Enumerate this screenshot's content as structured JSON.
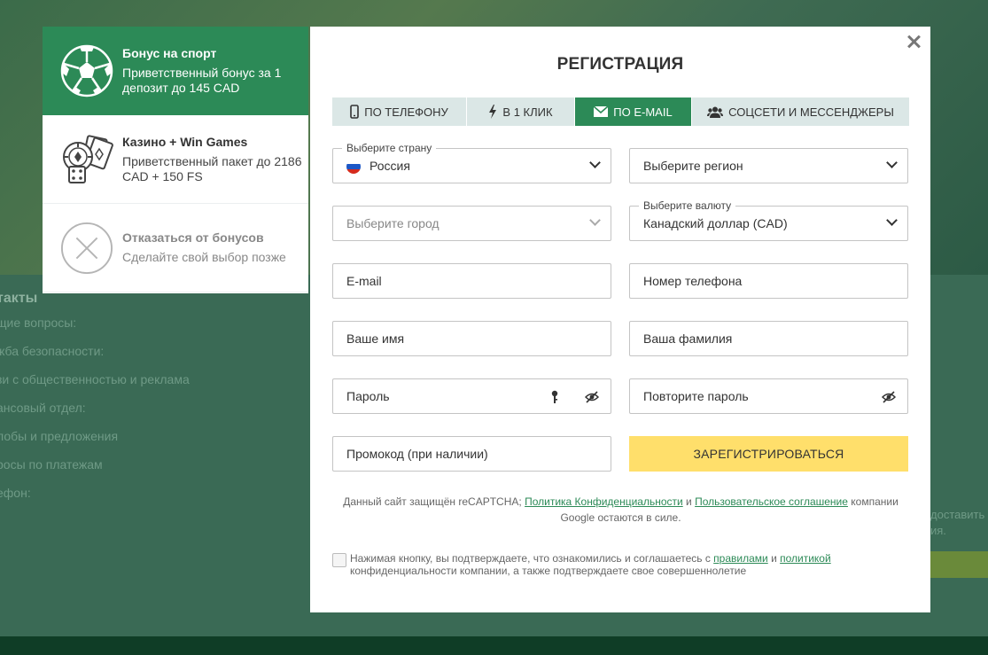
{
  "background": {
    "contacts_title": "такты",
    "contacts_links": [
      "щие вопросы:",
      "жба безопасности:",
      "зи с общественностью и реклама",
      "ансовый отдел:",
      "лобы и предложения",
      "росы по платежам",
      "ефон:"
    ],
    "right_text_line1": "доставить",
    "right_text_line2": "ия."
  },
  "bonus_panel": {
    "items": [
      {
        "title": "Бонус на спорт",
        "desc": "Приветственный бонус за 1 депозит до 145 CAD",
        "icon": "soccer-ball-icon"
      },
      {
        "title": "Казино + Win Games",
        "desc": "Приветственный пакет до 2186 CAD + 150 FS",
        "icon": "casino-chip-dice-icon"
      },
      {
        "title": "Отказаться от бонусов",
        "desc": "Сделайте свой выбор позже",
        "icon": "close-circle-icon"
      }
    ]
  },
  "modal": {
    "title": "РЕГИСТРАЦИЯ",
    "tabs": [
      {
        "label": "ПО ТЕЛЕФОНУ",
        "icon": "phone-icon"
      },
      {
        "label": "В 1 КЛИК",
        "icon": "lightning-icon"
      },
      {
        "label": "ПО E-MAIL",
        "icon": "envelope-icon"
      },
      {
        "label": "СОЦСЕТИ И МЕССЕНДЖЕРЫ",
        "icon": "users-icon"
      }
    ],
    "fields": {
      "country_label": "Выберите страну",
      "country_value": "Россия",
      "region_placeholder": "Выберите регион",
      "city_placeholder": "Выберите город",
      "currency_label": "Выберите валюту",
      "currency_value": "Канадский доллар (CAD)",
      "email_placeholder": "E-mail",
      "phone_placeholder": "Номер телефона",
      "firstname_placeholder": "Ваше имя",
      "lastname_placeholder": "Ваша фамилия",
      "password_placeholder": "Пароль",
      "password_repeat_placeholder": "Повторите пароль",
      "promo_placeholder": "Промокод (при наличии)"
    },
    "register_button": "ЗАРЕГИСТРИРОВАТЬСЯ",
    "recaptcha": {
      "prefix": "Данный сайт защищён reCAPTCHA; ",
      "privacy": "Политика Конфиденциальности",
      "and": " и ",
      "terms": "Пользовательское соглашение",
      "suffix": " компании Google остаются в силе."
    },
    "agree": {
      "prefix": "Нажимая кнопку, вы подтверждаете, что ознакомились и соглашаетесь с ",
      "rules": "правилами",
      "and": " и ",
      "policy": "политикой",
      "suffix": " конфиденциальности компании, а также подтверждаете свое совершеннолетие"
    }
  },
  "colors": {
    "accent_green": "#2c8a57",
    "button_yellow": "#ffdf6b",
    "tab_bg": "#dbe7e6"
  }
}
